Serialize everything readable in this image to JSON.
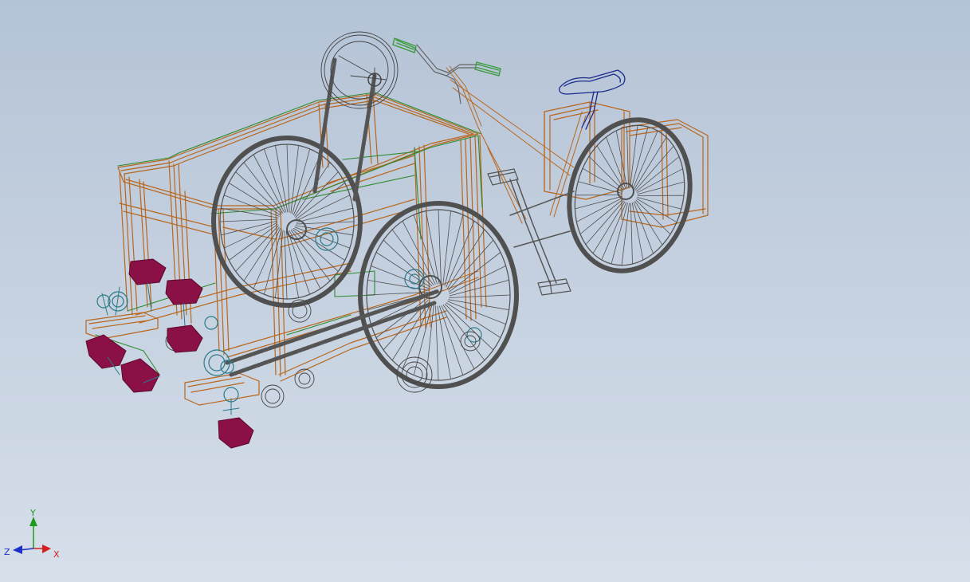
{
  "viewport": {
    "background_top": "#b4c3d6",
    "background_bottom": "#d6dfea"
  },
  "model": {
    "description_icon": "cad-wireframe-assembly",
    "colors": {
      "frame_orange": "#b9661c",
      "frame_green": "#2e8b2e",
      "wheel_gray": "#4a4a4a",
      "seat_blue": "#1c2a8c",
      "grip_green": "#3a9a3a",
      "block_magenta": "#8a1046",
      "hub_teal": "#2a7a8a"
    }
  },
  "triad": {
    "x_label": "X",
    "y_label": "Y",
    "z_label": "Z",
    "x_color": "#d42020",
    "y_color": "#1e9a1e",
    "z_color": "#1e2ec8"
  }
}
